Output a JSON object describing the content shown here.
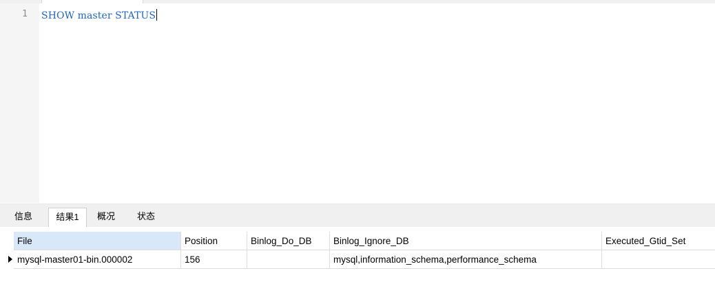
{
  "editor": {
    "line_number": "1",
    "code": "SHOW master STATUS"
  },
  "result_tabs": [
    {
      "label": "信息",
      "active": false
    },
    {
      "label": "结果1",
      "active": true
    },
    {
      "label": "概况",
      "active": false
    },
    {
      "label": "状态",
      "active": false
    }
  ],
  "table": {
    "columns": [
      "File",
      "Position",
      "Binlog_Do_DB",
      "Binlog_Ignore_DB",
      "Executed_Gtid_Set"
    ],
    "rows": [
      [
        "mysql-master01-bin.000002",
        "156",
        "",
        "mysql,information_schema,performance_schema",
        ""
      ]
    ]
  },
  "colors": {
    "keyword": "#1e64d2",
    "selected_header": "#d9e8f8"
  },
  "icons": {
    "current_row_indicator": "triangle-right-icon"
  }
}
